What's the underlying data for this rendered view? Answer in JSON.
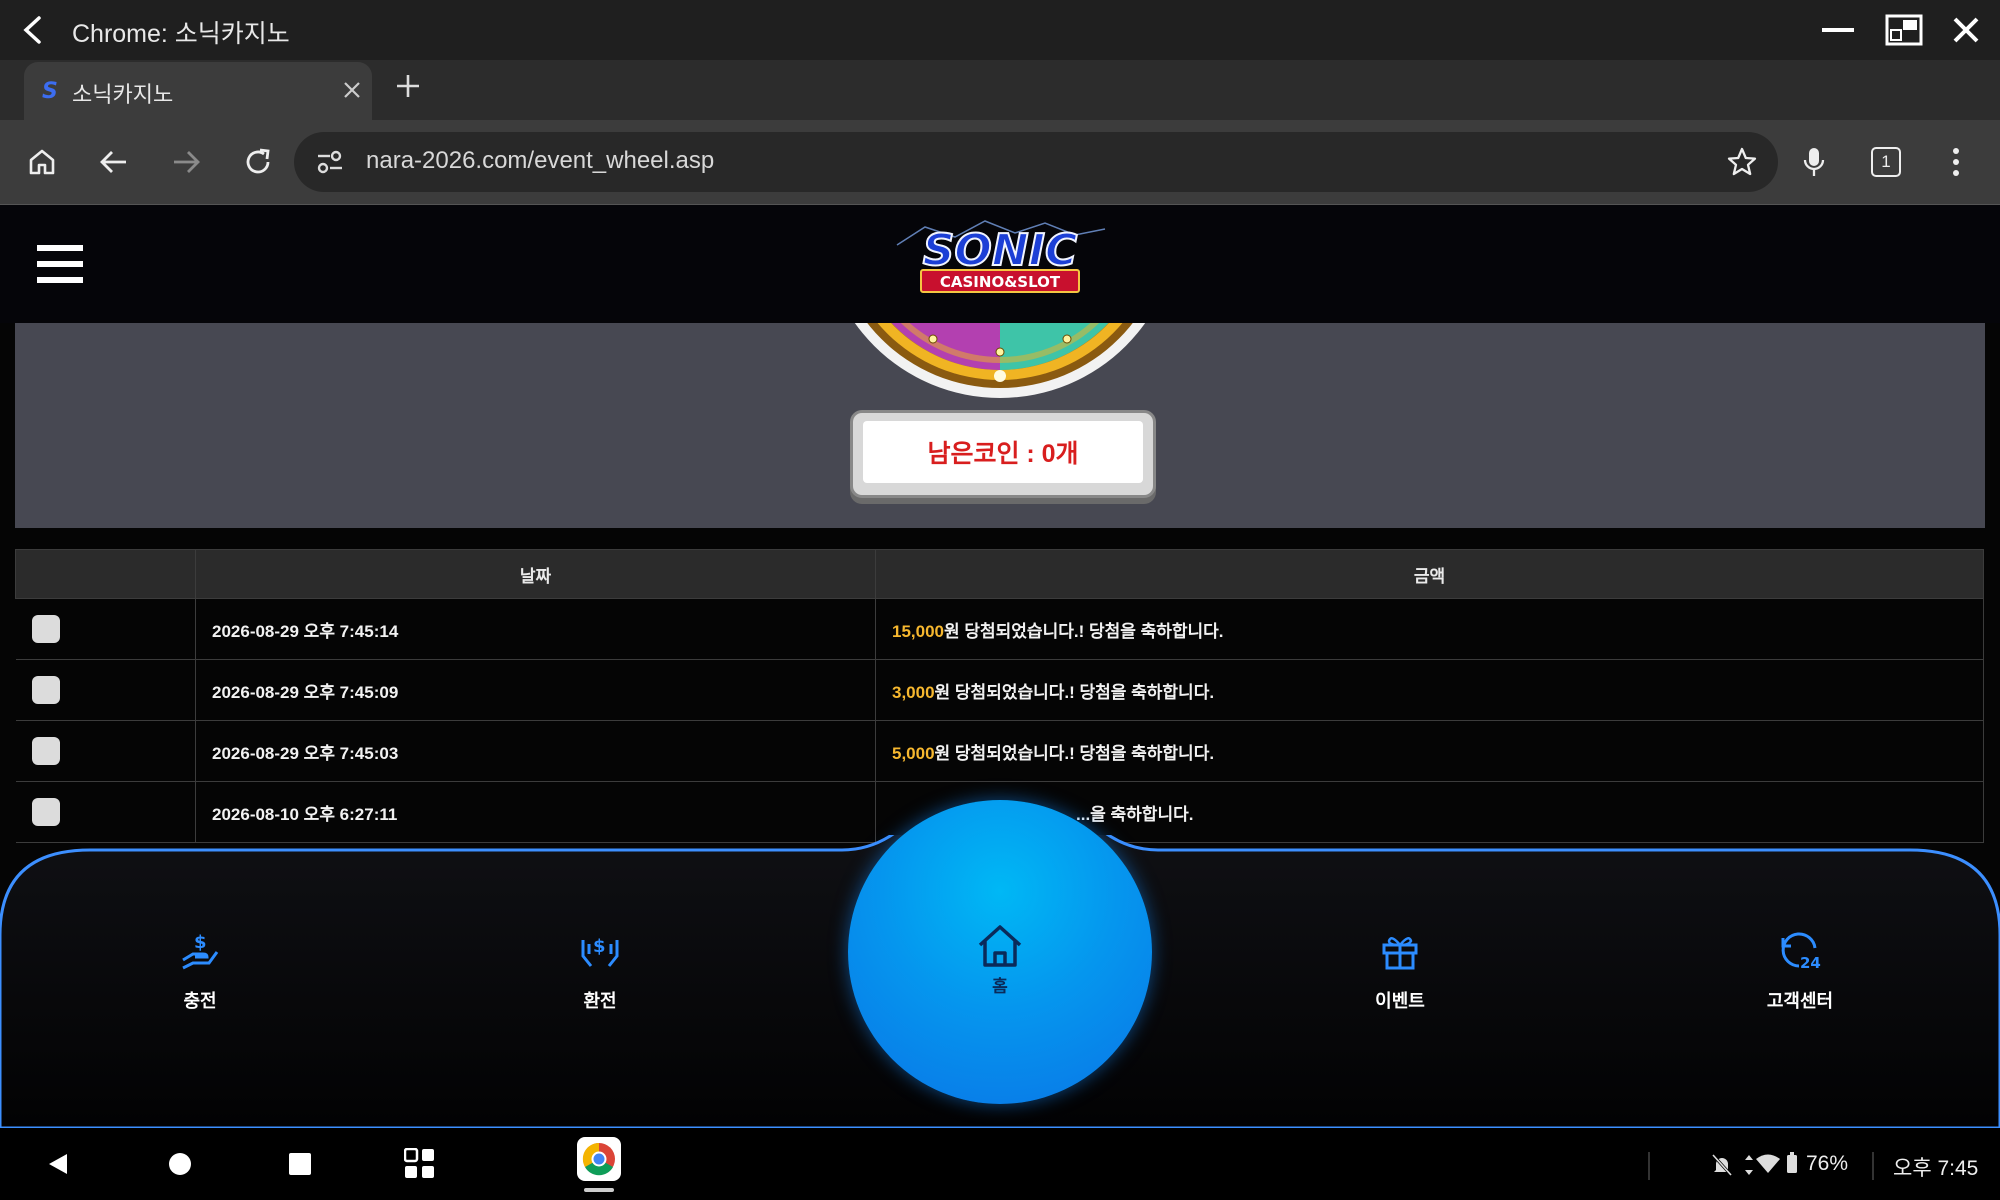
{
  "window": {
    "title": "Chrome: 소닉카지노"
  },
  "tab": {
    "title": "소닉카지노"
  },
  "toolbar": {
    "url": "nara-2026.com/event_wheel.asp",
    "tab_count": "1"
  },
  "site": {
    "logo_text": "SONIC",
    "logo_sub": "CASINO&SLOT",
    "remaining_coins": "남은코인 : 0개"
  },
  "table": {
    "headers": [
      "",
      "날짜",
      "금액"
    ],
    "rows": [
      {
        "date": "2026-08-29 오후 7:45:14",
        "amount": "15,000",
        "message": "원 당첨되었습니다.! 당첨을 축하합니다."
      },
      {
        "date": "2026-08-29 오후 7:45:09",
        "amount": "3,000",
        "message": "원 당첨되었습니다.! 당첨을 축하합니다."
      },
      {
        "date": "2026-08-29 오후 7:45:03",
        "amount": "5,000",
        "message": "원 당첨되었습니다.! 당첨을 축하합니다."
      },
      {
        "date": "2026-08-10 오후 6:27:11",
        "amount": "",
        "message": "...을 축하합니다."
      }
    ]
  },
  "bottom_nav": {
    "deposit": "충전",
    "withdraw": "환전",
    "home": "홈",
    "event": "이벤트",
    "support": "고객센터"
  },
  "status_bar": {
    "battery": "76%",
    "time": "오후 7:45"
  },
  "colors": {
    "accent_blue": "#0a8af0",
    "amount_gold": "#f7b82f",
    "coin_red": "#d81e1e"
  }
}
